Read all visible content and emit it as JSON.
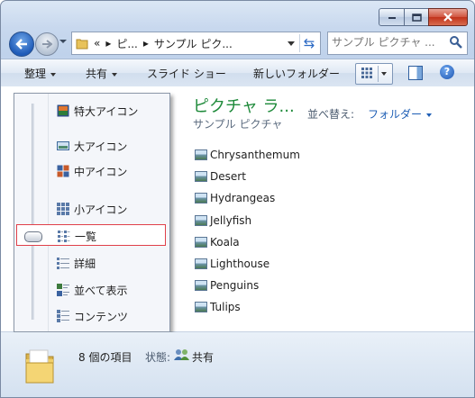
{
  "window": {
    "caption_buttons": [
      {
        "id": "min",
        "label": ""
      },
      {
        "id": "max",
        "label": ""
      },
      {
        "id": "close",
        "label": ""
      }
    ]
  },
  "address_bar": {
    "overflow": "«",
    "crumbs": [
      "ピ...",
      "サンプル ピク..."
    ]
  },
  "search": {
    "placeholder": "サンプル ピクチャ ..."
  },
  "toolbar": {
    "organize": "整理",
    "share": "共有",
    "slideshow": "スライド ショー",
    "new_folder": "新しいフォルダー"
  },
  "library": {
    "title": "ピクチャ ラ...",
    "subtitle": "サンプル ピクチャ",
    "arrange_label": "並べ替え:",
    "arrange_value": "フォルダー"
  },
  "files": [
    "Chrysanthemum",
    "Desert",
    "Hydrangeas",
    "Jellyfish",
    "Koala",
    "Lighthouse",
    "Penguins",
    "Tulips"
  ],
  "view_menu": {
    "items": [
      {
        "label": "特大アイコン",
        "icon": "extra-large-icons-icon"
      },
      {
        "label": "大アイコン",
        "icon": "large-icons-icon"
      },
      {
        "label": "中アイコン",
        "icon": "medium-icons-icon"
      },
      {
        "label": "小アイコン",
        "icon": "small-icons-icon"
      },
      {
        "label": "一覧",
        "icon": "list-view-icon"
      },
      {
        "label": "詳細",
        "icon": "details-view-icon"
      },
      {
        "label": "並べて表示",
        "icon": "tiles-view-icon"
      },
      {
        "label": "コンテンツ",
        "icon": "content-view-icon"
      }
    ],
    "selected": "一覧"
  },
  "status": {
    "count": "8 個の項目",
    "state_label": "状態:",
    "state_value": "共有"
  },
  "colors": {
    "title_green": "#1e8a3a",
    "link_blue": "#1e5eb5",
    "selection_border": "#e0404a"
  }
}
